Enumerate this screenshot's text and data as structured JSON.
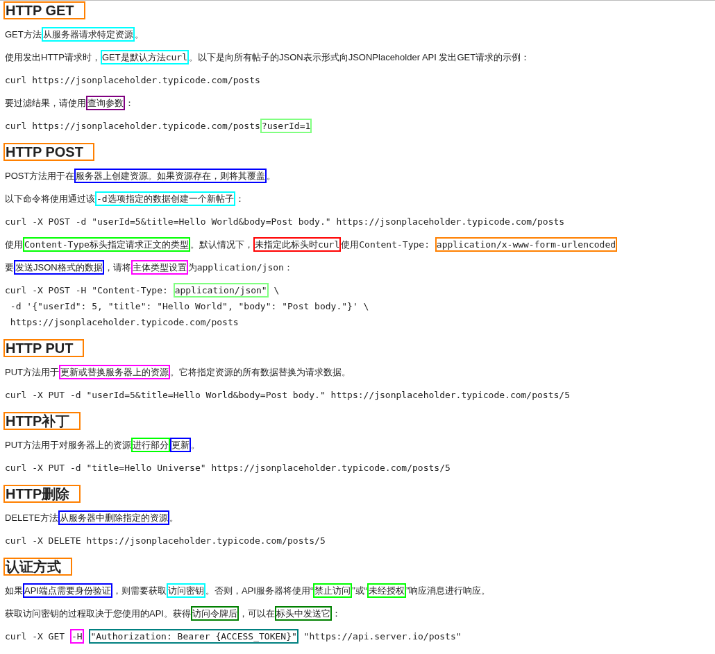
{
  "blocks": [
    {
      "kind": "heading",
      "text": "HTTP GET",
      "color": "#ff8000"
    },
    {
      "kind": "paragraph",
      "lines": [
        [
          {
            "text": "GET方法"
          },
          {
            "color": "#00ffff",
            "parts": [
              {
                "text": "从服务器请求特定资源"
              }
            ]
          },
          {
            "text": "。"
          }
        ]
      ]
    },
    {
      "kind": "paragraph",
      "lines": [
        [
          {
            "text": "使用发出HTTP请求时，"
          },
          {
            "color": "#00ffff",
            "parts": [
              {
                "text": "GET是默认方法"
              },
              {
                "code": "curl"
              }
            ]
          },
          {
            "text": "。以下是向所有帖子的JSON表示形式向JSONPlaceholder API 发出GET请求的示例："
          }
        ]
      ]
    },
    {
      "kind": "code",
      "lines": [
        [
          {
            "code": "curl https://jsonplaceholder.typicode.com/posts"
          }
        ]
      ]
    },
    {
      "kind": "paragraph",
      "lines": [
        [
          {
            "text": "要过滤结果，请使用"
          },
          {
            "color": "#800080",
            "parts": [
              {
                "text": "查询参数"
              }
            ]
          },
          {
            "text": "："
          }
        ]
      ]
    },
    {
      "kind": "code",
      "lines": [
        [
          {
            "code": "curl https://jsonplaceholder.typicode.com/posts"
          },
          {
            "color": "#80ff80",
            "parts": [
              {
                "code": "?userId=1"
              }
            ]
          }
        ]
      ]
    },
    {
      "kind": "heading",
      "text": "HTTP POST",
      "color": "#ff8000"
    },
    {
      "kind": "paragraph",
      "lines": [
        [
          {
            "text": "POST方法用于在"
          },
          {
            "color": "#0000ff",
            "parts": [
              {
                "text": "服务器上创建资源。如果资源存在，则将其覆盖"
              }
            ]
          },
          {
            "text": "。"
          }
        ]
      ]
    },
    {
      "kind": "paragraph",
      "lines": [
        [
          {
            "text": "以下命令将使用通过该"
          },
          {
            "color": "#00ffff",
            "parts": [
              {
                "code": "-d"
              },
              {
                "text": "选项指定的数据创建一个新帖子"
              }
            ]
          },
          {
            "text": "："
          }
        ]
      ]
    },
    {
      "kind": "code",
      "lines": [
        [
          {
            "code": "curl -X POST -d \"userId=5&title=Hello World&body=Post body.\" https://jsonplaceholder.typicode.com/posts"
          }
        ]
      ]
    },
    {
      "kind": "paragraph",
      "lines": [
        [
          {
            "text": "使用"
          },
          {
            "color": "#00ff00",
            "parts": [
              {
                "code": "Content-Type"
              },
              {
                "text": "标头指定请求正文的类型"
              }
            ]
          },
          {
            "text": "。默认情况下，"
          },
          {
            "color": "#ff0000",
            "parts": [
              {
                "text": "未指定此标头时"
              },
              {
                "code": "curl"
              }
            ]
          },
          {
            "text": "使用"
          },
          {
            "code": "Content-Type: "
          },
          {
            "color": "#ff8000",
            "parts": [
              {
                "code": "application/x-www-form-urlencoded"
              }
            ]
          }
        ]
      ]
    },
    {
      "kind": "paragraph",
      "lines": [
        [
          {
            "text": "要"
          },
          {
            "color": "#0000ff",
            "parts": [
              {
                "text": "发送JSON格式的数据"
              }
            ]
          },
          {
            "text": "，请将"
          },
          {
            "color": "#ff00ff",
            "parts": [
              {
                "text": "主体类型设置"
              }
            ]
          },
          {
            "text": "为"
          },
          {
            "code": "application/json"
          },
          {
            "text": "："
          }
        ]
      ]
    },
    {
      "kind": "code",
      "lines": [
        [
          {
            "code": "curl -X POST -H \"Content-Type: "
          },
          {
            "color": "#80ff80",
            "parts": [
              {
                "code": "application/json\""
              }
            ]
          },
          {
            "code": " \\"
          }
        ],
        [
          {
            "code": " -d '{\"userId\": 5, \"title\": \"Hello World\", \"body\": \"Post body.\"}' \\"
          }
        ],
        [
          {
            "code": " https://jsonplaceholder.typicode.com/posts"
          }
        ]
      ]
    },
    {
      "kind": "heading",
      "text": "HTTP PUT",
      "color": "#ff8000"
    },
    {
      "kind": "paragraph",
      "lines": [
        [
          {
            "text": "PUT方法用于"
          },
          {
            "color": "#ff00ff",
            "parts": [
              {
                "text": "更新或替换服务器上的资源"
              }
            ]
          },
          {
            "text": "。它将指定资源的所有数据替换为请求数据。"
          }
        ]
      ]
    },
    {
      "kind": "code",
      "lines": [
        [
          {
            "code": "curl -X PUT -d \"userId=5&title=Hello World&body=Post body.\" https://jsonplaceholder.typicode.com/posts/5"
          }
        ]
      ]
    },
    {
      "kind": "heading",
      "text": "HTTP补丁",
      "color": "#ff8000"
    },
    {
      "kind": "paragraph",
      "lines": [
        [
          {
            "text": "PUT方法用于对服务器上的资源"
          },
          {
            "color": "#00ff00",
            "parts": [
              {
                "text": "进行部分"
              }
            ]
          },
          {
            "color": "#0000ff",
            "parts": [
              {
                "text": "更新"
              }
            ]
          },
          {
            "text": "。"
          }
        ]
      ]
    },
    {
      "kind": "code",
      "lines": [
        [
          {
            "code": "curl -X PUT -d \"title=Hello Universe\" https://jsonplaceholder.typicode.com/posts/5"
          }
        ]
      ]
    },
    {
      "kind": "heading",
      "text": "HTTP删除",
      "color": "#ff8000"
    },
    {
      "kind": "paragraph",
      "lines": [
        [
          {
            "text": "DELETE方法"
          },
          {
            "color": "#0000ff",
            "parts": [
              {
                "text": "从服务器中删除指定的资源"
              }
            ]
          },
          {
            "text": "。"
          }
        ]
      ]
    },
    {
      "kind": "code",
      "lines": [
        [
          {
            "code": "curl -X DELETE https://jsonplaceholder.typicode.com/posts/5"
          }
        ]
      ]
    },
    {
      "kind": "heading",
      "text": "认证方式",
      "color": "#ff8000"
    },
    {
      "kind": "paragraph",
      "lines": [
        [
          {
            "text": "如果"
          },
          {
            "color": "#0000ff",
            "parts": [
              {
                "text": "API端点需要身份验证"
              }
            ]
          },
          {
            "text": "，则需要获取"
          },
          {
            "color": "#00ffff",
            "parts": [
              {
                "text": "访问密钥"
              }
            ]
          },
          {
            "text": "。否则，API服务器将使用“"
          },
          {
            "color": "#00ff00",
            "parts": [
              {
                "text": "禁止访问"
              }
            ]
          },
          {
            "text": "”或“"
          },
          {
            "color": "#00ff00",
            "parts": [
              {
                "text": "未经授权"
              }
            ]
          },
          {
            "text": "”响应消息进行响应。"
          }
        ]
      ]
    },
    {
      "kind": "paragraph",
      "lines": [
        [
          {
            "text": "获取访问密钥的过程取决于您使用的API。获得"
          },
          {
            "color": "#008000",
            "parts": [
              {
                "text": "访问令牌后"
              }
            ]
          },
          {
            "text": "，可以在"
          },
          {
            "color": "#008000",
            "parts": [
              {
                "text": "标头中发送它"
              }
            ]
          },
          {
            "text": "："
          }
        ]
      ]
    },
    {
      "kind": "code",
      "lines": [
        [
          {
            "code": "curl -X GET "
          },
          {
            "color": "#ff00ff",
            "parts": [
              {
                "code": "-H"
              }
            ]
          },
          {
            "color": "#008080",
            "parts": [
              {
                "code": "\"Authorization: Bearer {ACCESS_TOKEN}\""
              }
            ]
          },
          {
            "code": " \"https://api.server.io/posts\""
          }
        ]
      ]
    }
  ]
}
